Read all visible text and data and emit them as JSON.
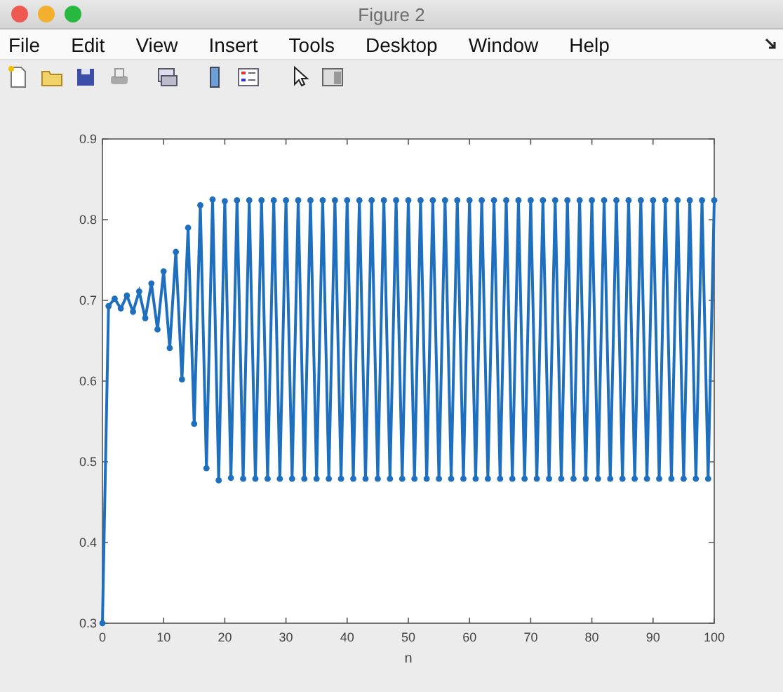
{
  "window": {
    "title": "Figure 2"
  },
  "menu": [
    "File",
    "Edit",
    "View",
    "Insert",
    "Tools",
    "Desktop",
    "Window",
    "Help"
  ],
  "figure": {
    "chart_data": {
      "type": "line",
      "xlabel": "n",
      "xlim": [
        0,
        100
      ],
      "ylim": [
        0.3,
        0.9
      ],
      "xticks": [
        0,
        10,
        20,
        30,
        40,
        50,
        60,
        70,
        80,
        90,
        100
      ],
      "x": [
        0,
        1,
        2,
        3,
        4,
        5,
        6,
        7,
        8,
        9,
        10,
        11,
        12,
        13,
        14,
        15,
        16,
        17,
        18,
        19,
        20,
        21,
        22,
        23,
        24,
        25,
        26,
        27,
        28,
        29,
        30,
        31,
        32,
        33,
        34,
        35,
        36,
        37,
        38,
        39,
        40,
        41,
        42,
        43,
        44,
        45,
        46,
        47,
        48,
        49,
        50,
        51,
        52,
        53,
        54,
        55,
        56,
        57,
        58,
        59,
        60,
        61,
        62,
        63,
        64,
        65,
        66,
        67,
        68,
        69,
        70,
        71,
        72,
        73,
        74,
        75,
        76,
        77,
        78,
        79,
        80,
        81,
        82,
        83,
        84,
        85,
        86,
        87,
        88,
        89,
        90,
        91,
        92,
        93,
        94,
        95,
        96,
        97,
        98,
        99,
        100
      ],
      "yticks": [
        0.3,
        0.4,
        0.5,
        0.6,
        0.7,
        0.8,
        0.9
      ],
      "series": [
        {
          "color": "#1f6fbf",
          "marker": "circle",
          "values": [
            0.3,
            0.693,
            0.702,
            0.69,
            0.706,
            0.686,
            0.711,
            0.678,
            0.721,
            0.664,
            0.736,
            0.641,
            0.76,
            0.602,
            0.79,
            0.547,
            0.818,
            0.492,
            0.825,
            0.477,
            0.823,
            0.48,
            0.824,
            0.479,
            0.824,
            0.479,
            0.824,
            0.479,
            0.824,
            0.479,
            0.824,
            0.479,
            0.824,
            0.479,
            0.824,
            0.479,
            0.824,
            0.479,
            0.824,
            0.479,
            0.824,
            0.479,
            0.824,
            0.479,
            0.824,
            0.479,
            0.824,
            0.479,
            0.824,
            0.479,
            0.824,
            0.479,
            0.824,
            0.479,
            0.824,
            0.479,
            0.824,
            0.479,
            0.824,
            0.479,
            0.824,
            0.479,
            0.824,
            0.479,
            0.824,
            0.479,
            0.824,
            0.479,
            0.824,
            0.479,
            0.824,
            0.479,
            0.824,
            0.479,
            0.824,
            0.479,
            0.824,
            0.479,
            0.824,
            0.479,
            0.824,
            0.479,
            0.824,
            0.479,
            0.824,
            0.479,
            0.824,
            0.479,
            0.824,
            0.479,
            0.824,
            0.479,
            0.824,
            0.479,
            0.824,
            0.479,
            0.824,
            0.479,
            0.824,
            0.479,
            0.824
          ]
        }
      ]
    }
  }
}
